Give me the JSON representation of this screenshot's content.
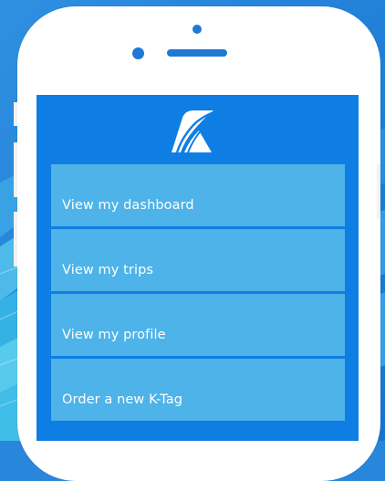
{
  "app": {
    "logo": "k-logo-icon"
  },
  "menu": {
    "items": [
      {
        "label": "View my dashboard"
      },
      {
        "label": "View my trips"
      },
      {
        "label": "View my profile"
      },
      {
        "label": "Order a new K-Tag"
      }
    ]
  },
  "colors": {
    "screen_bg": "#0e7ee4",
    "menu_item_bg": "#4eb3e8",
    "phone_body": "#ffffff",
    "background": "#2a86da"
  }
}
